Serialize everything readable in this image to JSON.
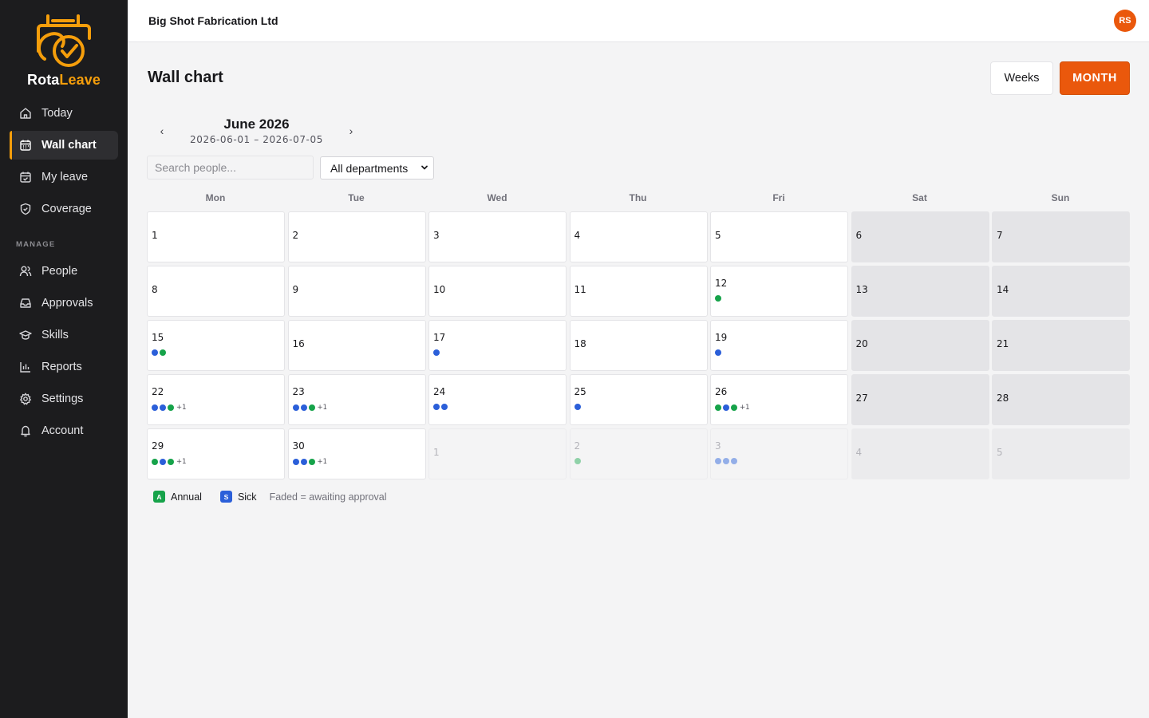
{
  "app": {
    "name_part1": "Rota",
    "name_part2": "Leave"
  },
  "colors": {
    "accent": "#ea580c",
    "brand": "#f59e0b",
    "annual": "#16a34a",
    "sick": "#2b5fd9"
  },
  "sidebar": {
    "items": [
      {
        "id": "today",
        "label": "Today",
        "icon": "home-icon"
      },
      {
        "id": "wall-chart",
        "label": "Wall chart",
        "icon": "calendar-icon",
        "active": true
      },
      {
        "id": "my-leave",
        "label": "My leave",
        "icon": "calendar-check-icon"
      },
      {
        "id": "coverage",
        "label": "Coverage",
        "icon": "shield-check-icon"
      }
    ],
    "manage_label": "MANAGE",
    "manage_items": [
      {
        "id": "people",
        "label": "People",
        "icon": "users-icon"
      },
      {
        "id": "approvals",
        "label": "Approvals",
        "icon": "inbox-icon"
      },
      {
        "id": "skills",
        "label": "Skills",
        "icon": "graduation-cap-icon"
      },
      {
        "id": "reports",
        "label": "Reports",
        "icon": "bar-chart-icon"
      },
      {
        "id": "settings",
        "label": "Settings",
        "icon": "gear-icon"
      },
      {
        "id": "account",
        "label": "Account",
        "icon": "bell-icon"
      }
    ]
  },
  "header": {
    "company": "Big Shot Fabrication Ltd",
    "avatar_initials": "RS"
  },
  "page": {
    "title": "Wall chart",
    "view_weeks": "Weeks",
    "view_month": "MONTH",
    "month_label": "June 2026",
    "range": "2026-06-01 – 2026-07-05",
    "prev": "‹",
    "next": "›",
    "search_placeholder": "Search people...",
    "department": "All departments"
  },
  "weekdays": [
    "Mon",
    "Tue",
    "Wed",
    "Thu",
    "Fri",
    "Sat",
    "Sun"
  ],
  "calendar": [
    {
      "day": "1"
    },
    {
      "day": "2"
    },
    {
      "day": "3"
    },
    {
      "day": "4"
    },
    {
      "day": "5"
    },
    {
      "day": "6",
      "weekend": true
    },
    {
      "day": "7",
      "weekend": true
    },
    {
      "day": "8"
    },
    {
      "day": "9"
    },
    {
      "day": "10"
    },
    {
      "day": "11"
    },
    {
      "day": "12",
      "dots": [
        "annual"
      ]
    },
    {
      "day": "13",
      "weekend": true
    },
    {
      "day": "14",
      "weekend": true
    },
    {
      "day": "15",
      "dots": [
        "sick",
        "annual"
      ]
    },
    {
      "day": "16"
    },
    {
      "day": "17",
      "dots": [
        "sick"
      ]
    },
    {
      "day": "18"
    },
    {
      "day": "19",
      "dots": [
        "sick"
      ]
    },
    {
      "day": "20",
      "weekend": true
    },
    {
      "day": "21",
      "weekend": true
    },
    {
      "day": "22",
      "dots": [
        "sick",
        "sick",
        "annual"
      ],
      "more": "+1"
    },
    {
      "day": "23",
      "dots": [
        "sick",
        "sick",
        "annual"
      ],
      "more": "+1"
    },
    {
      "day": "24",
      "dots": [
        "sick",
        "sick"
      ]
    },
    {
      "day": "25",
      "dots": [
        "sick"
      ]
    },
    {
      "day": "26",
      "dots": [
        "annual",
        "sick",
        "annual"
      ],
      "more": "+1"
    },
    {
      "day": "27",
      "weekend": true
    },
    {
      "day": "28",
      "weekend": true
    },
    {
      "day": "29",
      "dots": [
        "annual",
        "sick",
        "annual"
      ],
      "more": "+1"
    },
    {
      "day": "30",
      "dots": [
        "sick",
        "sick",
        "annual"
      ],
      "more": "+1"
    },
    {
      "day": "1",
      "outside": true
    },
    {
      "day": "2",
      "outside": true,
      "dots": [
        "annual"
      ]
    },
    {
      "day": "3",
      "outside": true,
      "dots": [
        "sick",
        "sick",
        "sick"
      ]
    },
    {
      "day": "4",
      "outside": true,
      "weekend": true
    },
    {
      "day": "5",
      "outside": true,
      "weekend": true
    }
  ],
  "legend": {
    "annual_badge": "A",
    "annual": "Annual",
    "sick_badge": "S",
    "sick": "Sick",
    "note": "Faded = awaiting approval"
  }
}
